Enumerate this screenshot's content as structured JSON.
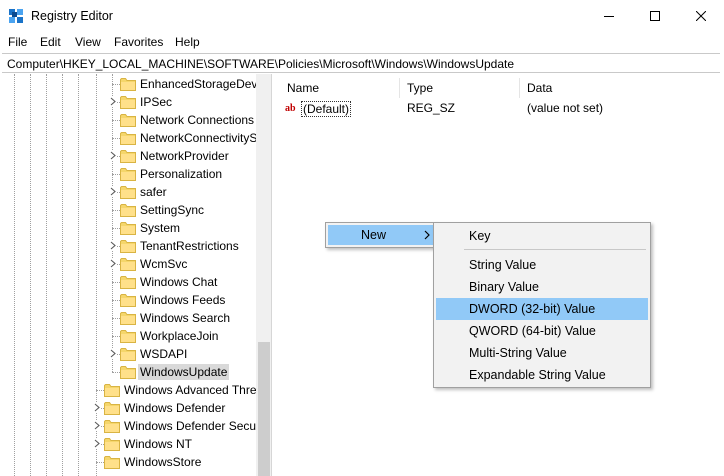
{
  "window": {
    "title": "Registry Editor",
    "icon": "registry-icon",
    "controls": [
      "minimize-icon",
      "maximize-icon",
      "close-icon"
    ]
  },
  "menu": {
    "items": [
      {
        "label": "File"
      },
      {
        "label": "Edit"
      },
      {
        "label": "View"
      },
      {
        "label": "Favorites"
      },
      {
        "label": "Help"
      }
    ]
  },
  "address": {
    "path": "Computer\\HKEY_LOCAL_MACHINE\\SOFTWARE\\Policies\\Microsoft\\Windows\\WindowsUpdate"
  },
  "tree": {
    "children": [
      {
        "label": "EnhancedStorageDevi",
        "expandable": false
      },
      {
        "label": "IPSec",
        "expandable": true
      },
      {
        "label": "Network Connections",
        "expandable": false
      },
      {
        "label": "NetworkConnectivityS",
        "expandable": false
      },
      {
        "label": "NetworkProvider",
        "expandable": true
      },
      {
        "label": "Personalization",
        "expandable": false
      },
      {
        "label": "safer",
        "expandable": true
      },
      {
        "label": "SettingSync",
        "expandable": false
      },
      {
        "label": "System",
        "expandable": false
      },
      {
        "label": "TenantRestrictions",
        "expandable": true
      },
      {
        "label": "WcmSvc",
        "expandable": true
      },
      {
        "label": "Windows Chat",
        "expandable": false
      },
      {
        "label": "Windows Feeds",
        "expandable": false
      },
      {
        "label": "Windows Search",
        "expandable": false
      },
      {
        "label": "WorkplaceJoin",
        "expandable": false
      },
      {
        "label": "WSDAPI",
        "expandable": true
      },
      {
        "label": "WindowsUpdate",
        "expandable": false,
        "selected": true
      }
    ],
    "siblings": [
      {
        "label": "Windows Advanced Thre",
        "expandable": false
      },
      {
        "label": "Windows Defender",
        "expandable": true
      },
      {
        "label": "Windows Defender Secur",
        "expandable": true
      },
      {
        "label": "Windows NT",
        "expandable": true
      },
      {
        "label": "WindowsStore",
        "expandable": false
      }
    ]
  },
  "list": {
    "columns": [
      "Name",
      "Type",
      "Data"
    ],
    "rows": [
      {
        "name": "(Default)",
        "type": "REG_SZ",
        "data": "(value not set)",
        "icon": "string-value-icon"
      }
    ]
  },
  "context_menu": {
    "label": "New",
    "submenu": {
      "items": [
        {
          "label": "Key",
          "highlighted": false
        },
        {
          "label": "String Value",
          "highlighted": false
        },
        {
          "label": "Binary Value",
          "highlighted": false
        },
        {
          "label": "DWORD (32-bit) Value",
          "highlighted": true
        },
        {
          "label": "QWORD (64-bit) Value",
          "highlighted": false
        },
        {
          "label": "Multi-String Value",
          "highlighted": false
        },
        {
          "label": "Expandable String Value",
          "highlighted": false
        }
      ]
    }
  },
  "colors": {
    "highlight": "#91c9f7",
    "folder": "#f5d66b",
    "selected_tree": "#d9d9d9"
  }
}
